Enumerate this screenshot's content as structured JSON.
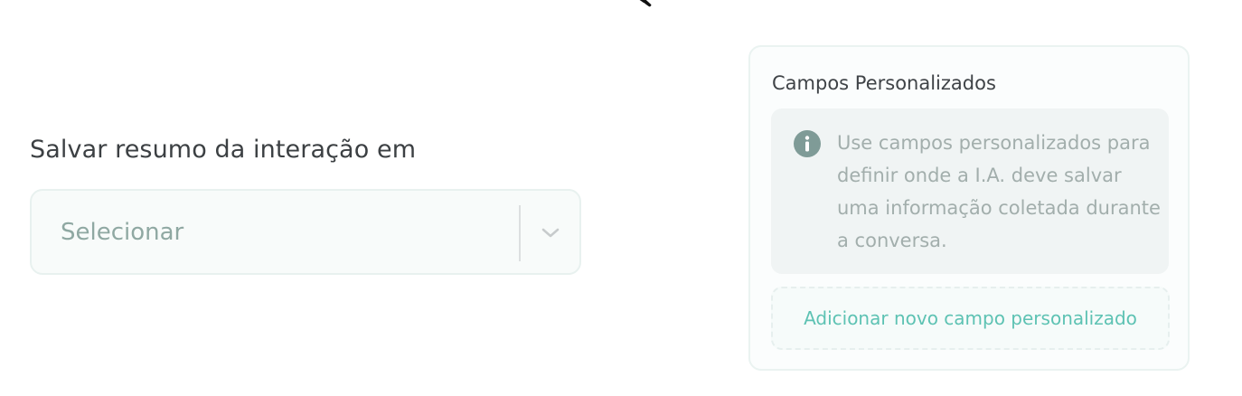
{
  "summary_field": {
    "label": "Salvar resumo da interação em",
    "select_placeholder": "Selecionar"
  },
  "custom_fields_panel": {
    "title": "Campos Personalizados",
    "info_text": "Use campos personalizados para definir onde a I.A. deve salvar uma informação coletada durante a conversa.",
    "add_button_label": "Adicionar novo campo personalizado"
  },
  "icons": {
    "cursor": "pointer-cursor-icon",
    "chevron": "chevron-down-icon",
    "info": "info-icon"
  },
  "colors": {
    "accent": "#5dc2b3",
    "info_icon": "#7f9b97",
    "placeholder": "#8fa8a2"
  }
}
